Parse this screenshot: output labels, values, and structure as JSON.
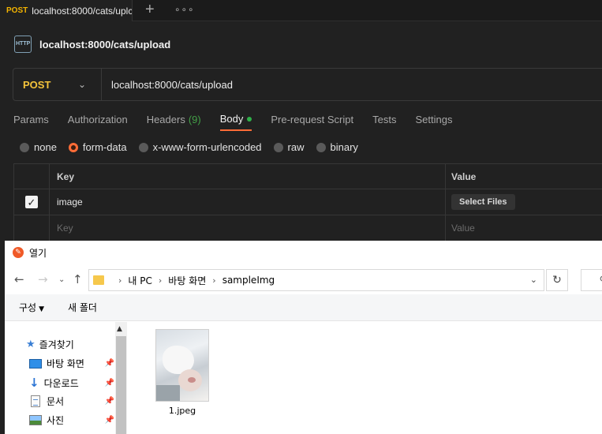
{
  "tabbar": {
    "active_tab": {
      "method": "POST",
      "url": "localhost:8000/cats/uplc"
    }
  },
  "request": {
    "title": "localhost:8000/cats/upload",
    "icon_label": "HTTP",
    "method": "POST",
    "url": "localhost:8000/cats/upload"
  },
  "request_tabs": [
    {
      "label": "Params"
    },
    {
      "label": "Authorization"
    },
    {
      "label": "Headers",
      "count": "(9)"
    },
    {
      "label": "Body"
    },
    {
      "label": "Pre-request Script"
    },
    {
      "label": "Tests"
    },
    {
      "label": "Settings"
    }
  ],
  "body_types": [
    {
      "label": "none",
      "selected": false
    },
    {
      "label": "form-data",
      "selected": true
    },
    {
      "label": "x-www-form-urlencoded",
      "selected": false
    },
    {
      "label": "raw",
      "selected": false
    },
    {
      "label": "binary",
      "selected": false
    }
  ],
  "form_table": {
    "headers": {
      "key": "Key",
      "value": "Value"
    },
    "rows": [
      {
        "checked": true,
        "key": "image",
        "value_button": "Select Files"
      }
    ],
    "placeholder": {
      "key": "Key",
      "value": "Value"
    }
  },
  "dialog": {
    "title": "열기",
    "path": [
      "내 PC",
      "바탕 화면",
      "sampleImg"
    ],
    "toolbar": {
      "organize": "구성",
      "new_folder": "새 폴더"
    },
    "nav_items": [
      {
        "label": "즐겨찾기"
      },
      {
        "label": "바탕 화면"
      },
      {
        "label": "다운로드"
      },
      {
        "label": "문서"
      },
      {
        "label": "사진"
      }
    ],
    "files": [
      {
        "name": "1.jpeg"
      }
    ]
  },
  "colors": {
    "accent": "#ff6c37",
    "method_post": "#f4c33b",
    "body_dot": "#2fb14a",
    "headers_count": "#43a047"
  }
}
